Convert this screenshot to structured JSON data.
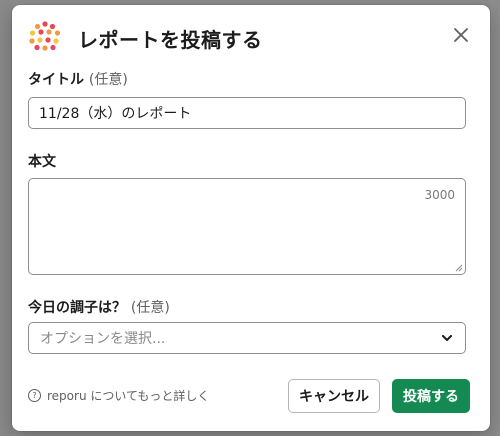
{
  "modal": {
    "title": "レポートを投稿する",
    "logo_icon": "reporu-logo-icon",
    "close_icon": "close-icon"
  },
  "form": {
    "title_label": "タイトル",
    "title_optional": "(任意)",
    "title_value": "11/28（水）のレポート",
    "body_label": "本文",
    "body_value": "",
    "body_counter": "3000",
    "mood_label": "今日の調子は？",
    "mood_optional": "(任意)",
    "mood_placeholder": "オプションを選択...",
    "mood_chevron_icon": "chevron-down-icon"
  },
  "footer": {
    "help_icon": "question-circle-icon",
    "help_text": "reporu についてもっと詳しく",
    "cancel_label": "キャンセル",
    "submit_label": "投稿する"
  },
  "colors": {
    "primary_button": "#148a52",
    "logo_red": "#e8445a",
    "logo_orange": "#f29b38",
    "logo_yellow": "#f5c53f"
  }
}
